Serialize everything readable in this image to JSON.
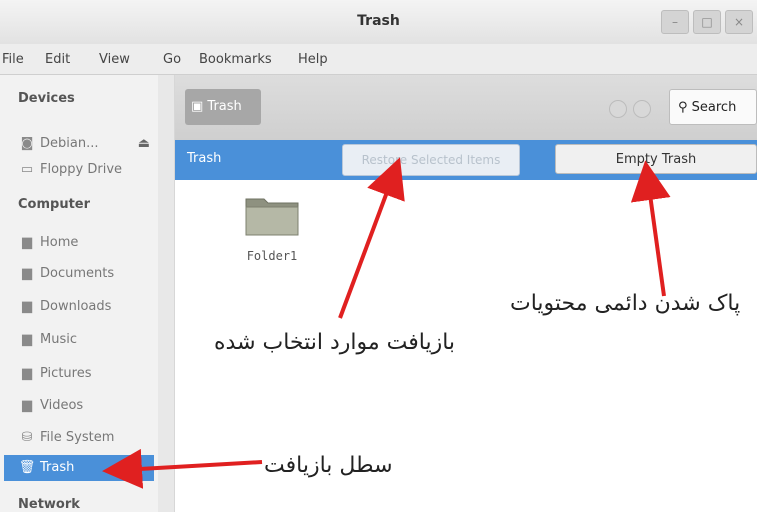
{
  "window": {
    "title": "Trash"
  },
  "menubar": [
    "File",
    "Edit",
    "View",
    "Go",
    "Bookmarks",
    "Help"
  ],
  "sidebar": {
    "devices_heading": "Devices",
    "devices": [
      {
        "icon": "disk-icon",
        "label": "Debian..."
      },
      {
        "icon": "floppy-icon",
        "label": "Floppy Drive"
      }
    ],
    "computer_heading": "Computer",
    "computer": [
      {
        "icon": "folder-icon",
        "label": "Home"
      },
      {
        "icon": "folder-icon",
        "label": "Documents"
      },
      {
        "icon": "folder-icon",
        "label": "Downloads"
      },
      {
        "icon": "folder-icon",
        "label": "Music"
      },
      {
        "icon": "folder-icon",
        "label": "Pictures"
      },
      {
        "icon": "folder-icon",
        "label": "Videos"
      },
      {
        "icon": "filesystem-icon",
        "label": "File System"
      },
      {
        "icon": "trash-icon",
        "label": "Trash"
      }
    ],
    "network_heading": "Network"
  },
  "toolbar": {
    "breadcrumb": "Trash",
    "search_label": "Search"
  },
  "infobar": {
    "label": "Trash",
    "restore_label": "Restore Selected Items",
    "empty_label": "Empty Trash"
  },
  "files": [
    {
      "name": "Folder1"
    }
  ],
  "annotations": {
    "restore": "بازیافت موارد انتخاب شده",
    "empty": "پاک شدن دائمی محتویات",
    "trash": "سطل بازیافت"
  },
  "colors": {
    "accent": "#4a90d9",
    "arrow": "#e02020"
  }
}
